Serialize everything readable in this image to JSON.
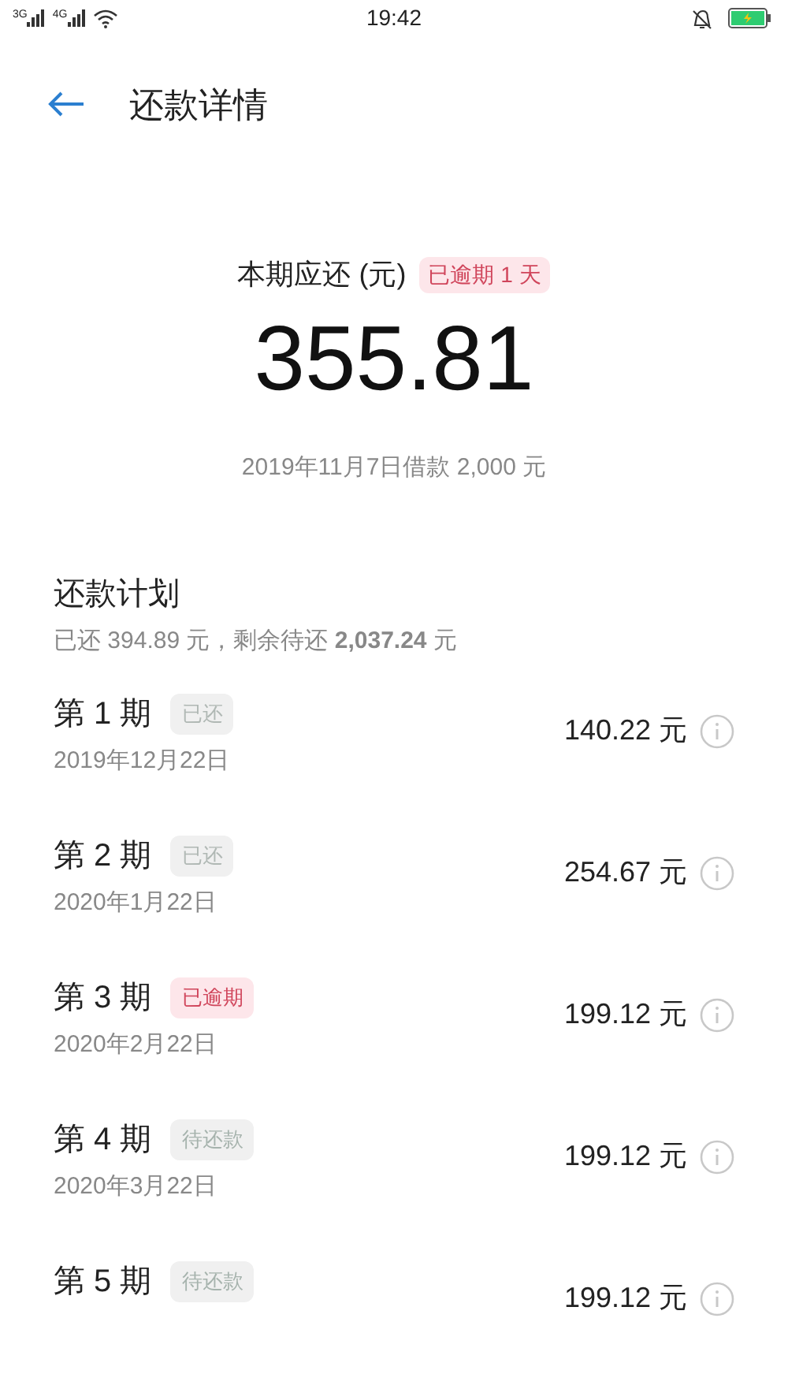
{
  "status_bar": {
    "signal_1": "3G",
    "signal_2": "4G",
    "time": "19:42"
  },
  "header": {
    "title": "还款详情"
  },
  "current": {
    "label": "本期应还 (元)",
    "badge": "已逾期 1 天",
    "amount": "355.81",
    "loan": "2019年11月7日借款 2,000 元"
  },
  "plan": {
    "title": "还款计划",
    "summary": "已还 394.89 元，剩余待还 **2,037.24** 元",
    "installments": [
      {
        "period": "第 1 期",
        "status": "已还",
        "kind": "paid",
        "date": "2019年12月22日",
        "amount": "140.22 元"
      },
      {
        "period": "第 2 期",
        "status": "已还",
        "kind": "paid",
        "date": "2020年1月22日",
        "amount": "254.67 元"
      },
      {
        "period": "第 3 期",
        "status": "已逾期",
        "kind": "overdue",
        "date": "2020年2月22日",
        "amount": "199.12 元"
      },
      {
        "period": "第 4 期",
        "status": "待还款",
        "kind": "pending",
        "date": "2020年3月22日",
        "amount": "199.12 元"
      },
      {
        "period": "第 5 期",
        "status": "待还款",
        "kind": "pending",
        "amount": "199.12 元"
      }
    ]
  }
}
